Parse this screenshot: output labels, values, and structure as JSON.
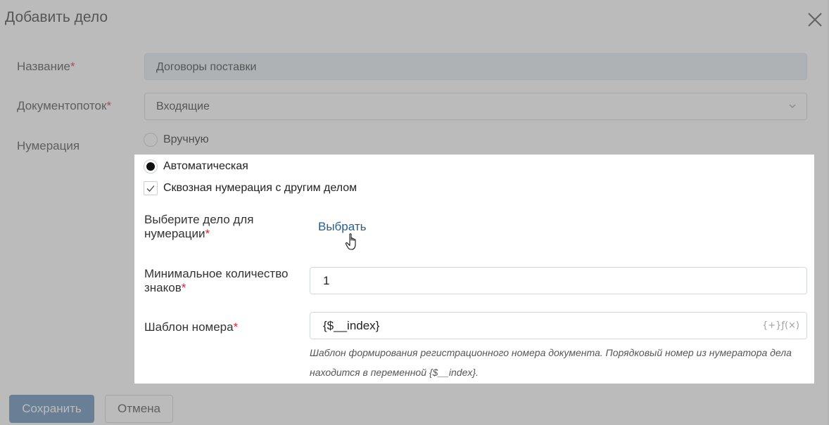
{
  "dialog": {
    "title": "Добавить дело"
  },
  "form": {
    "name": {
      "label": "Название",
      "required_mark": "*",
      "value": "Договоры поставки"
    },
    "docflow": {
      "label": "Документопоток",
      "required_mark": "*",
      "value": "Входящие"
    },
    "numbering": {
      "label": "Нумерация",
      "options": [
        {
          "label": "Вручную",
          "selected": false
        },
        {
          "label": "Автоматическая",
          "selected": true
        }
      ],
      "through_numbering": {
        "label": "Сквозная нумерация с другим делом",
        "checked": true
      }
    },
    "select_case": {
      "label_line1": "Выберите дело для",
      "label_line2": "нумерации",
      "required_mark": "*",
      "action_label": "Выбрать"
    },
    "min_digits": {
      "label_line1": "Минимальное количество",
      "label_line2": "знаков",
      "required_mark": "*",
      "value": "1"
    },
    "number_template": {
      "label": "Шаблон номера",
      "required_mark": "*",
      "value": "{$__index}",
      "fx_icon_text": "{+}ƒ(×)",
      "hint": "Шаблон формирования регистрационного номера документа. Порядковый номер из нумератора дела находится в переменной {$__index}."
    }
  },
  "footer": {
    "save_label": "Сохранить",
    "cancel_label": "Отмена"
  },
  "icons": {
    "close": "close-icon",
    "chevron": "chevron-down-icon",
    "check": "check-icon",
    "cursor": "hand-pointer-icon"
  },
  "colors": {
    "accent": "#1f5f99",
    "required": "#d9252b",
    "primary_button": "#5a86b3"
  }
}
